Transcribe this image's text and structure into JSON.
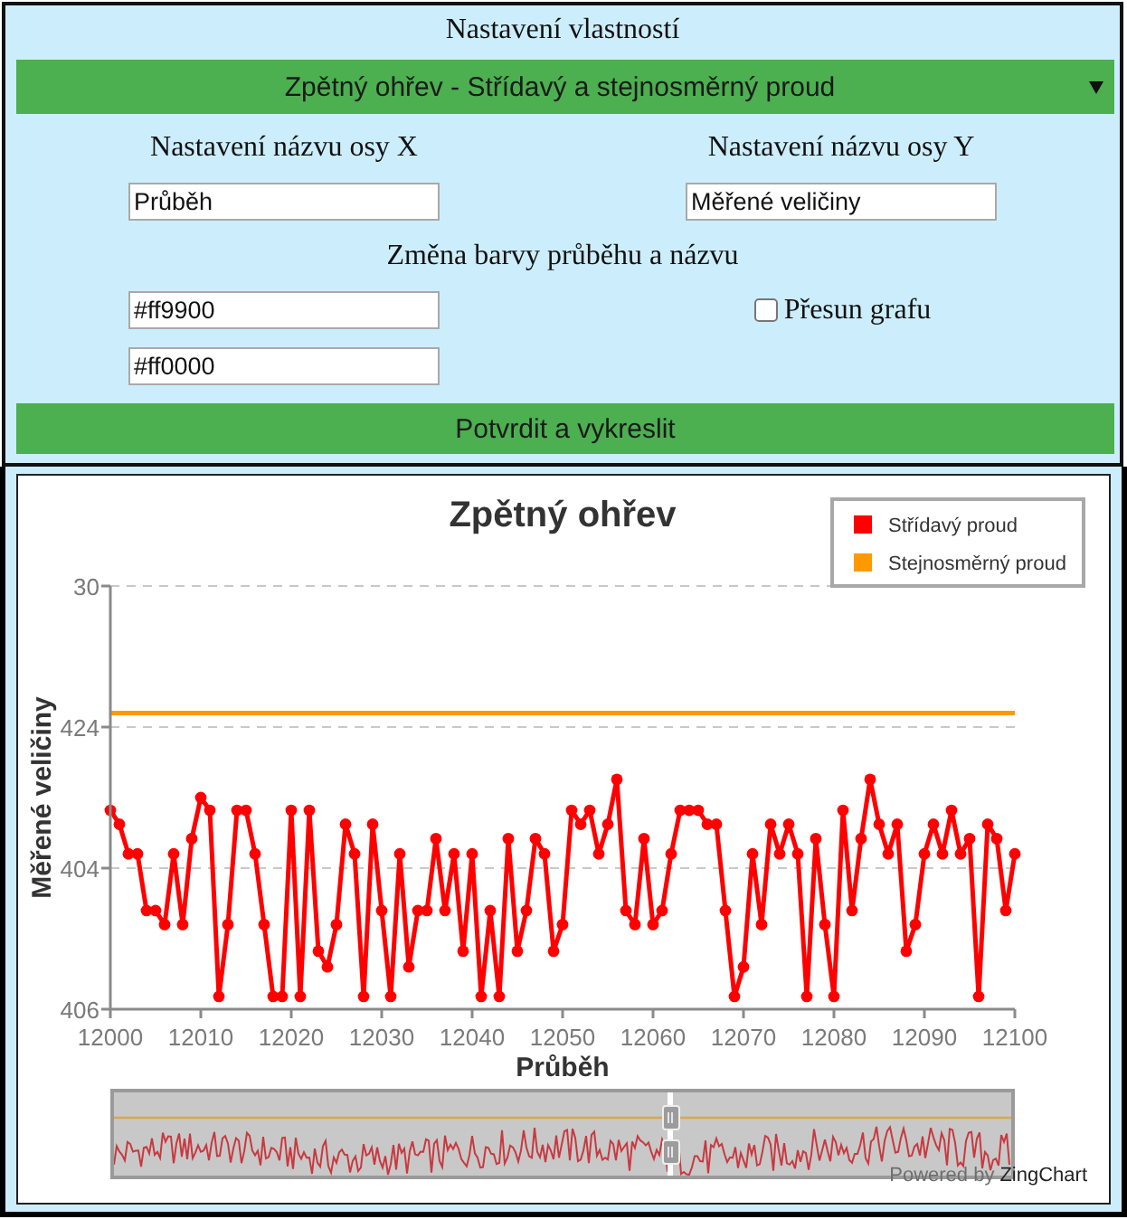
{
  "settings_panel": {
    "title": "Nastavení vlastností",
    "chart_select": "Zpětný ohřev - Střídavý a stejnosměrný proud",
    "x_axis_name": {
      "label": "Nastavení názvu osy X",
      "value": "Průběh"
    },
    "y_axis_name": {
      "label": "Nastavení názvu osy Y",
      "value": "Měřené veličiny"
    },
    "colors": {
      "label": "Změna barvy průběhu a názvu",
      "inputs": [
        {
          "value": "#ff9900"
        },
        {
          "value": "#ff0000"
        }
      ]
    },
    "move_chart": {
      "label": "Přesun grafu",
      "checked": false
    },
    "submit_button": "Potvrdit a vykreslit"
  },
  "chart": {
    "title": "Zpětný ohřev",
    "legend": [
      {
        "label": "Střídavý proud",
        "color": "#ff0000"
      },
      {
        "label": "Stejnosměrný proud",
        "color": "#ff9900"
      }
    ],
    "y_axis": {
      "title": "Měřené veličiny",
      "ticks": [
        "30",
        "424",
        "404",
        "406"
      ]
    },
    "x_axis": {
      "title": "Průběh",
      "ticks": [
        "12000",
        "12010",
        "12020",
        "12030",
        "12040",
        "12050",
        "12060",
        "12070",
        "12080",
        "12090",
        "12100"
      ]
    },
    "preview": {
      "level": 0.62
    },
    "credit": {
      "text": "Powered by",
      "link": "ZingChart"
    }
  }
}
